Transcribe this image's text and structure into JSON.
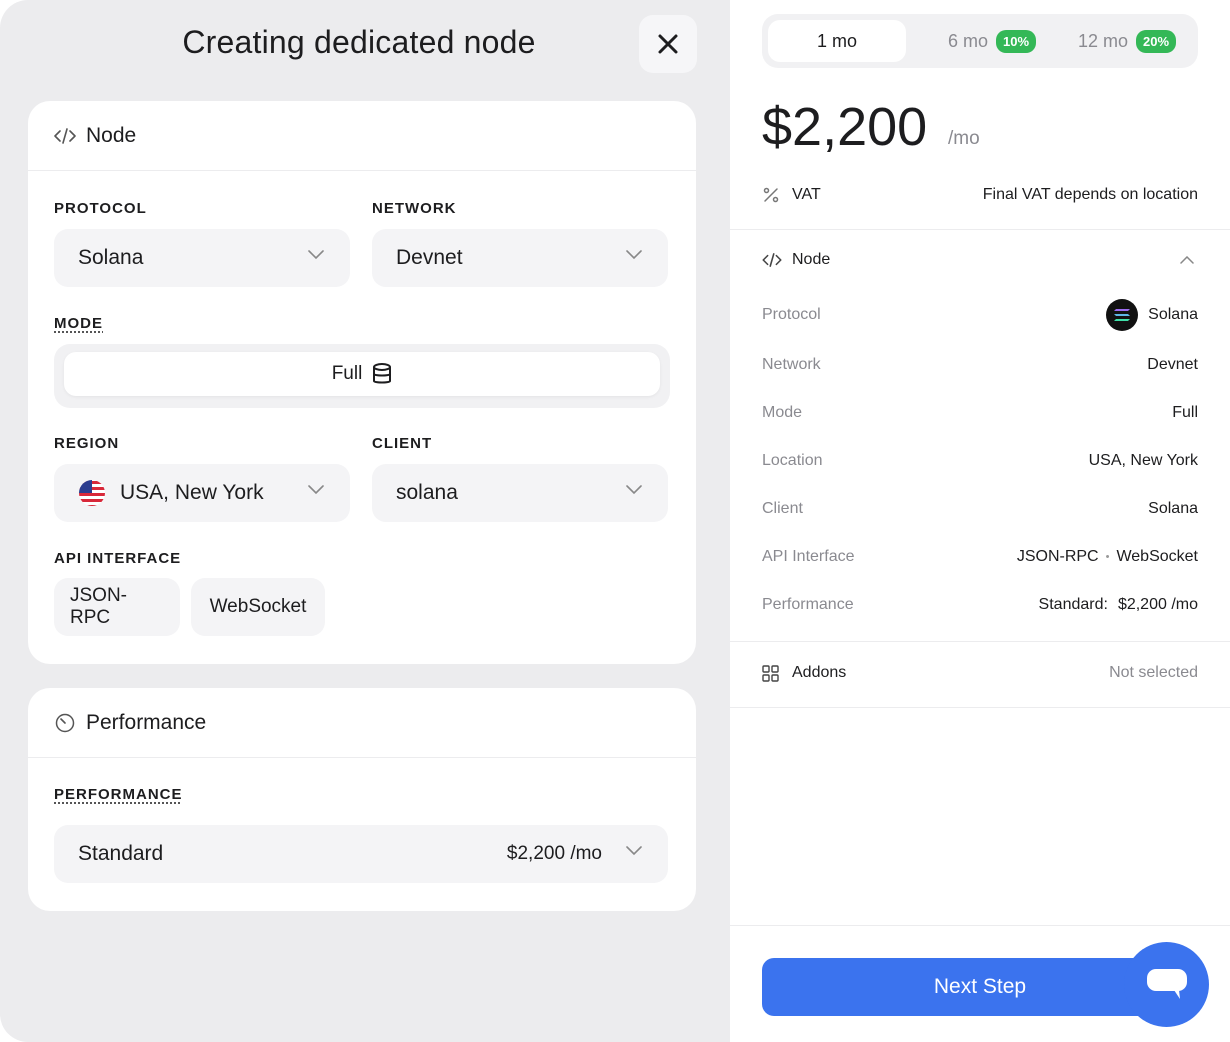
{
  "modal": {
    "title": "Creating dedicated node"
  },
  "node_card": {
    "title": "Node",
    "protocol_label": "PROTOCOL",
    "protocol_value": "Solana",
    "network_label": "NETWORK",
    "network_value": "Devnet",
    "mode_label": "MODE",
    "mode_value": "Full",
    "region_label": "REGION",
    "region_value": "USA, New York",
    "client_label": "CLIENT",
    "client_value": "solana",
    "api_label": "API INTERFACE",
    "api_options": [
      "JSON-RPC",
      "WebSocket"
    ]
  },
  "performance_card": {
    "title": "Performance",
    "label": "PERFORMANCE",
    "value": "Standard",
    "price": "$2,200 /mo"
  },
  "pricing": {
    "periods": [
      {
        "label": "1 mo",
        "badge": ""
      },
      {
        "label": "6 mo",
        "badge": "10%"
      },
      {
        "label": "12 mo",
        "badge": "20%"
      }
    ],
    "price": "$2,200",
    "per": "/mo",
    "vat_label": "VAT",
    "vat_value": "Final VAT depends on location"
  },
  "summary": {
    "node_title": "Node",
    "rows": [
      {
        "key": "Protocol",
        "value": "Solana"
      },
      {
        "key": "Network",
        "value": "Devnet"
      },
      {
        "key": "Mode",
        "value": "Full"
      },
      {
        "key": "Location",
        "value": "USA, New York"
      },
      {
        "key": "Client",
        "value": "Solana"
      },
      {
        "key": "API Interface",
        "value_a": "JSON-RPC",
        "sep": "•",
        "value_b": "WebSocket"
      },
      {
        "key": "Performance",
        "value_a": "Standard:",
        "value_b": "$2,200 /mo"
      }
    ],
    "addons_label": "Addons",
    "addons_value": "Not selected"
  },
  "actions": {
    "next_label": "Next Step"
  },
  "colors": {
    "accent": "#3b73ee",
    "badge": "#34b857",
    "panel_bg": "#ececee"
  }
}
